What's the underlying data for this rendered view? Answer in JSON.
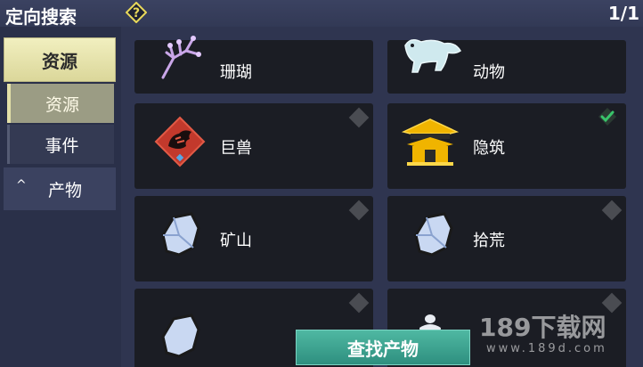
{
  "header": {
    "title": "定向搜索",
    "help_icon": "question-diamond-icon",
    "pager": "1/1"
  },
  "sidebar": {
    "main_tab": "资源",
    "sub_items": [
      {
        "label": "资源",
        "selected": true
      },
      {
        "label": "事件",
        "selected": false
      }
    ],
    "section": {
      "label": "产物",
      "caret": "^"
    }
  },
  "cards": [
    {
      "label": "珊瑚",
      "icon": "coral-icon"
    },
    {
      "label": "动物",
      "icon": "animal-icon"
    },
    {
      "label": "巨兽",
      "icon": "beast-icon",
      "marker": "diamond"
    },
    {
      "label": "隐筑",
      "icon": "hidden-building-icon",
      "marker": "check"
    },
    {
      "label": "矿山",
      "icon": "ore-icon",
      "marker": "diamond"
    },
    {
      "label": "拾荒",
      "icon": "ore-icon",
      "marker": "diamond"
    },
    {
      "label": "",
      "icon": "ore-icon",
      "marker": "diamond"
    },
    {
      "label": "",
      "icon": "pot-icon",
      "marker": "diamond"
    }
  ],
  "actions": {
    "find_label": "查找产物"
  },
  "watermark": {
    "main": "189下载网",
    "sub": "www.189d.com"
  },
  "colors": {
    "accent_check": "#39c46a",
    "button": "#3ea692",
    "selected_tab": "#e9e6ad"
  }
}
